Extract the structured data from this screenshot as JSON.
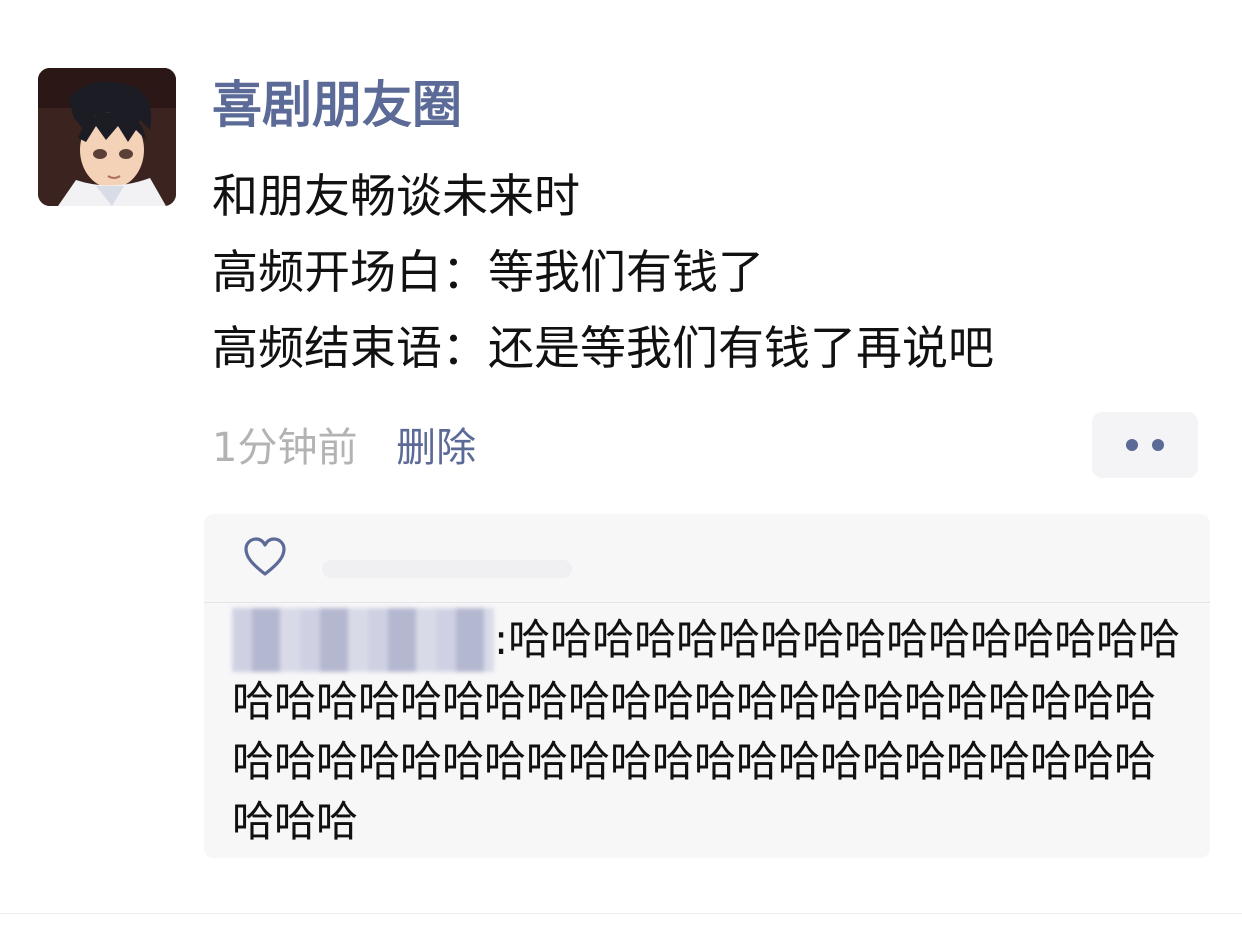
{
  "post": {
    "author": "喜剧朋友圈",
    "lines": [
      "和朋友畅谈未来时",
      "高频开场白：等我们有钱了",
      "高频结束语：还是等我们有钱了再说吧"
    ],
    "timestamp": "1分钟前",
    "delete_label": "删除"
  },
  "interactions": {
    "like_icon": "heart-outline-icon",
    "comments": [
      {
        "separator": ":",
        "text": "哈哈哈哈哈哈哈哈哈哈哈哈哈哈哈哈哈哈哈哈哈哈哈哈哈哈哈哈哈哈哈哈哈哈哈哈哈哈哈哈哈哈哈哈哈哈哈哈哈哈哈哈哈哈哈哈哈哈哈哈哈哈哈"
      }
    ]
  },
  "colors": {
    "name_blue": "#5b6a96",
    "timestamp_gray": "#b3b3b3",
    "comment_bg": "#f7f7f8"
  }
}
